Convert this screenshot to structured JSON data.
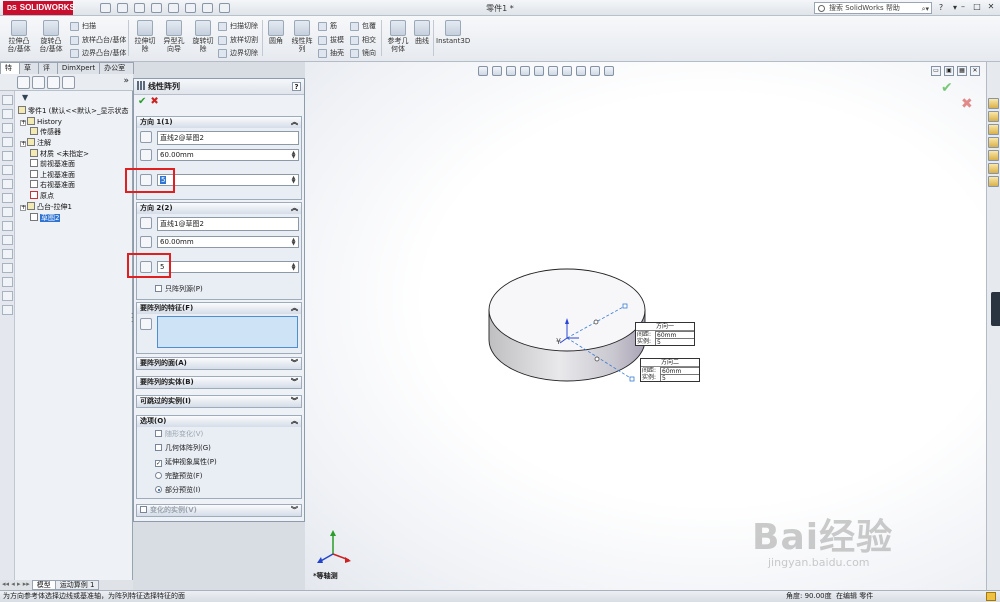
{
  "titlebar": {
    "brand": "SOLIDWORKS",
    "doc_title": "零件1 *",
    "search_placeholder": "搜索 SolidWorks 帮助"
  },
  "ribbon": {
    "buttons": [
      {
        "label": "拉伸凸\n台/基体"
      },
      {
        "label": "旋转凸\n台/基体"
      },
      {
        "label": "拉伸切\n除"
      },
      {
        "label": "异型孔\n向导"
      },
      {
        "label": "旋转切\n除"
      },
      {
        "label": "圆角"
      },
      {
        "label": "线性阵\n列"
      },
      {
        "label": "参考几\n何体"
      },
      {
        "label": "曲线"
      },
      {
        "label": "Instant3D"
      }
    ],
    "small_items": [
      "扫描",
      "放样凸台/基体",
      "边界凸台/基体",
      "扫描切除",
      "放样切割",
      "边界切除",
      "筋",
      "拔模",
      "抽壳",
      "包覆",
      "相交",
      "镜向"
    ]
  },
  "left_tabs": [
    "特征",
    "草图",
    "评估",
    "DimXpert",
    "办公室产品"
  ],
  "active_tab": "特征",
  "tree": {
    "root": "零件1 (默认<<默认>_显示状态",
    "items": [
      "History",
      "传感器",
      "注解",
      "材质 <未指定>",
      "前视基准面",
      "上视基准面",
      "右视基准面",
      "原点",
      "凸台-拉伸1",
      "草图2"
    ]
  },
  "bottom_tabs": [
    "模型",
    "运动算例 1"
  ],
  "property_manager": {
    "title": "线性阵列",
    "help": "?",
    "dir1": {
      "header": "方向 1(1)",
      "edge": "直线2@草图2",
      "spacing": "60.00mm",
      "instances": "5"
    },
    "dir2": {
      "header": "方向 2(2)",
      "edge": "直线1@草图2",
      "spacing": "60.00mm",
      "instances": "5",
      "seed_only": "只阵列源(P)"
    },
    "features_header": "要阵列的特征(F)",
    "faces_header": "要阵列的面(A)",
    "bodies_header": "要阵列的实体(B)",
    "skip_header": "可跳过的实例(I)",
    "options": {
      "header": "选项(O)",
      "vary_sketch": "随形变化(V)",
      "geometry_pattern": "几何体阵列(G)",
      "propagate_visual": "延伸视象属性(P)",
      "full_preview": "完整预览(F)",
      "partial_preview": "部分预览(I)"
    },
    "varying_header": "变化的实例(V)"
  },
  "viewport": {
    "view_label": "*等轴测",
    "callout1": {
      "title": "方向一",
      "spacing_label": "间距:",
      "spacing_value": "60mm",
      "count_label": "实例:",
      "count_value": "5"
    },
    "callout2": {
      "title": "方向二",
      "spacing_label": "间距:",
      "spacing_value": "60mm",
      "count_label": "实例:",
      "count_value": "5"
    }
  },
  "statusbar": {
    "hint": "为方向参考体选择边线或基准轴，为阵列特征选择特征的面",
    "angle": "角度: 90.00度",
    "mode": "在编辑 零件"
  },
  "watermark": {
    "brand": "Bai经验",
    "url": "jingyan.baidu.com"
  }
}
